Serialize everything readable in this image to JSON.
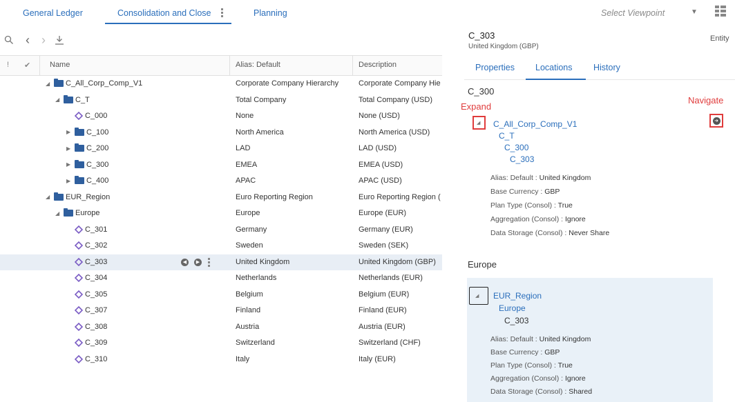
{
  "top_tabs": [
    {
      "label": "General Ledger"
    },
    {
      "label": "Consolidation and Close"
    },
    {
      "label": "Planning"
    }
  ],
  "viewpoint": {
    "placeholder": "Select Viewpoint"
  },
  "table": {
    "headers": {
      "flag": "!",
      "check": "✔",
      "name": "Name",
      "alias": "Alias: Default",
      "description": "Description"
    },
    "rows": [
      {
        "name": "C_All_Corp_Comp_V1",
        "alias": "Corporate Company Hierarchy",
        "desc": "Corporate Company Hie"
      },
      {
        "name": "C_T",
        "alias": "Total Company",
        "desc": "Total Company (USD)"
      },
      {
        "name": "C_000",
        "alias": "None",
        "desc": "None (USD)"
      },
      {
        "name": "C_100",
        "alias": "North America",
        "desc": "North America (USD)"
      },
      {
        "name": "C_200",
        "alias": "LAD",
        "desc": "LAD (USD)"
      },
      {
        "name": "C_300",
        "alias": "EMEA",
        "desc": "EMEA (USD)"
      },
      {
        "name": "C_400",
        "alias": "APAC",
        "desc": "APAC (USD)"
      },
      {
        "name": "EUR_Region",
        "alias": "Euro Reporting Region",
        "desc": "Euro Reporting Region ("
      },
      {
        "name": "Europe",
        "alias": "Europe",
        "desc": "Europe (EUR)"
      },
      {
        "name": "C_301",
        "alias": "Germany",
        "desc": "Germany (EUR)"
      },
      {
        "name": "C_302",
        "alias": "Sweden",
        "desc": "Sweden (SEK)"
      },
      {
        "name": "C_303",
        "alias": "United Kingdom",
        "desc": "United Kingdom (GBP)"
      },
      {
        "name": "C_304",
        "alias": "Netherlands",
        "desc": "Netherlands (EUR)"
      },
      {
        "name": "C_305",
        "alias": "Belgium",
        "desc": "Belgium (EUR)"
      },
      {
        "name": "C_307",
        "alias": "Finland",
        "desc": "Finland (EUR)"
      },
      {
        "name": "C_308",
        "alias": "Austria",
        "desc": "Austria (EUR)"
      },
      {
        "name": "C_309",
        "alias": "Switzerland",
        "desc": "Switzerland (CHF)"
      },
      {
        "name": "C_310",
        "alias": "Italy",
        "desc": "Italy (EUR)"
      }
    ]
  },
  "panel": {
    "title": "C_303",
    "subtitle": "United Kingdom (GBP)",
    "entity_label": "Entity",
    "tabs": [
      {
        "label": "Properties"
      },
      {
        "label": "Locations"
      },
      {
        "label": "History"
      }
    ],
    "annotations": {
      "expand": "Expand",
      "navigate": "Navigate"
    },
    "locations": [
      {
        "heading": "C_300",
        "path": [
          "C_All_Corp_Comp_V1",
          "C_T",
          "C_300",
          "C_303"
        ],
        "props": [
          {
            "label": "Alias: Default :",
            "value": "United Kingdom"
          },
          {
            "label": "Base Currency :",
            "value": "GBP"
          },
          {
            "label": "Plan Type (Consol) :",
            "value": "True"
          },
          {
            "label": "Aggregation (Consol) :",
            "value": "Ignore"
          },
          {
            "label": "Data Storage (Consol) :",
            "value": "Never Share"
          }
        ]
      },
      {
        "heading": "Europe",
        "path": [
          "EUR_Region",
          "Europe",
          "C_303"
        ],
        "props": [
          {
            "label": "Alias: Default :",
            "value": "United Kingdom"
          },
          {
            "label": "Base Currency :",
            "value": "GBP"
          },
          {
            "label": "Plan Type (Consol) :",
            "value": "True"
          },
          {
            "label": "Aggregation (Consol) :",
            "value": "Ignore"
          },
          {
            "label": "Data Storage (Consol) :",
            "value": "Shared"
          }
        ]
      }
    ]
  },
  "colors": {
    "accent": "#2a6ebb",
    "annotation": "#e03c3c",
    "selected_row": "#e8eef5",
    "shared_bg": "#e9f1f8"
  }
}
